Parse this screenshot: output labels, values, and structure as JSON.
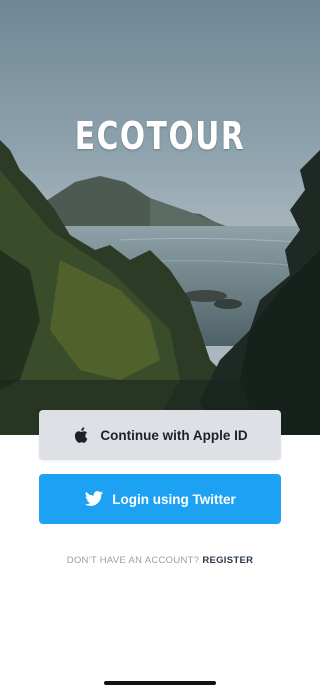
{
  "app": {
    "title": "ECOTOUR"
  },
  "auth": {
    "apple_label": "Continue with Apple ID",
    "twitter_label": "Login using Twitter",
    "register_prompt": "DON'T HAVE AN ACCOUNT?",
    "register_link": "REGISTER"
  },
  "icons": {
    "apple": "apple-logo-icon",
    "twitter": "twitter-bird-icon"
  },
  "colors": {
    "apple_button_bg": "#dde0e4",
    "twitter_button_bg": "#1da1f2",
    "register_link": "#2b3a4a"
  }
}
